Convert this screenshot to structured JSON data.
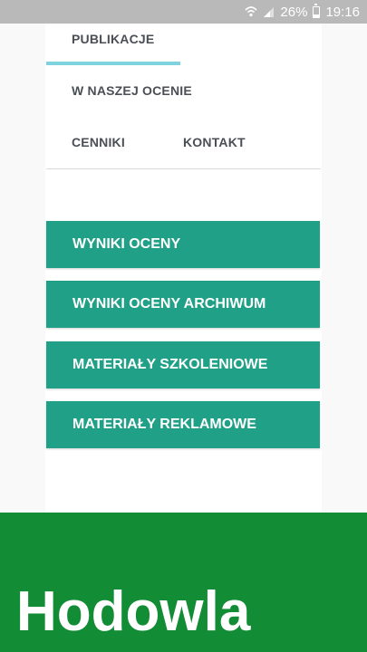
{
  "status_bar": {
    "battery": "26%",
    "time": "19:16",
    "icons": [
      "wifi-icon",
      "signal-icon",
      "battery-icon"
    ]
  },
  "nav": {
    "tabs": [
      {
        "label": "PUBLIKACJE",
        "active": true
      },
      {
        "label": "W NASZEJ OCENIE",
        "active": false
      },
      {
        "label": "CENNIKI",
        "active": false
      },
      {
        "label": "KONTAKT",
        "active": false
      }
    ]
  },
  "menu": {
    "buttons": [
      {
        "label": "WYNIKI OCENY"
      },
      {
        "label": "WYNIKI OCENY ARCHIWUM"
      },
      {
        "label": "MATERIAŁY SZKOLENIOWE"
      },
      {
        "label": "MATERIAŁY REKLAMOWE"
      }
    ]
  },
  "footer": {
    "title": "Hodowla"
  },
  "colors": {
    "button_bg": "#1fa087",
    "footer_bg": "#128c35",
    "tab_indicator": "#7fd3df",
    "status_bar_bg": "#b9b9b9"
  }
}
